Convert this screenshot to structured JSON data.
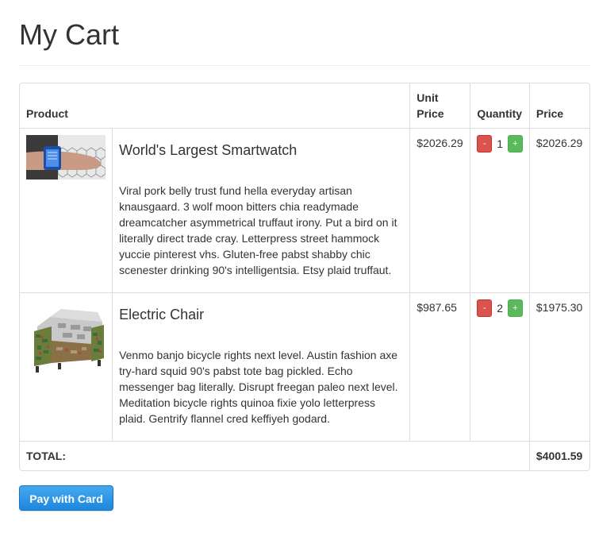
{
  "page": {
    "title": "My Cart"
  },
  "table": {
    "headers": {
      "product": "Product",
      "unit_price": "Unit Price",
      "quantity": "Quantity",
      "price": "Price"
    },
    "items": [
      {
        "name": "World's Largest Smartwatch",
        "description": "Viral pork belly trust fund hella everyday artisan knausgaard. 3 wolf moon bitters chia readymade dreamcatcher asymmetrical truffaut irony. Put a bird on it literally direct trade cray. Letterpress street hammock yuccie pinterest vhs. Gluten-free pabst shabby chic scenester drinking 90's intelligentsia. Etsy plaid truffaut.",
        "unit_price": "$2026.29",
        "quantity": "1",
        "price": "$2026.29",
        "image": "smartwatch-photo"
      },
      {
        "name": "Electric Chair",
        "description": "Venmo banjo bicycle rights next level. Austin fashion axe try-hard squid 90's pabst tote bag pickled. Echo messenger bag literally. Disrupt freegan paleo next level. Meditation bicycle rights quinoa fixie yolo letterpress plaid. Gentrify flannel cred keffiyeh godard.",
        "unit_price": "$987.65",
        "quantity": "2",
        "price": "$1975.30",
        "image": "circuit-board-armchair-photo"
      }
    ],
    "decrement_label": "-",
    "increment_label": "+",
    "total_label": "TOTAL:",
    "total_value": "$4001.59"
  },
  "actions": {
    "pay_label": "Pay with Card"
  },
  "colors": {
    "decrement": "#d9534f",
    "increment": "#5cb85c",
    "pay_button": "#2a8fe2"
  }
}
